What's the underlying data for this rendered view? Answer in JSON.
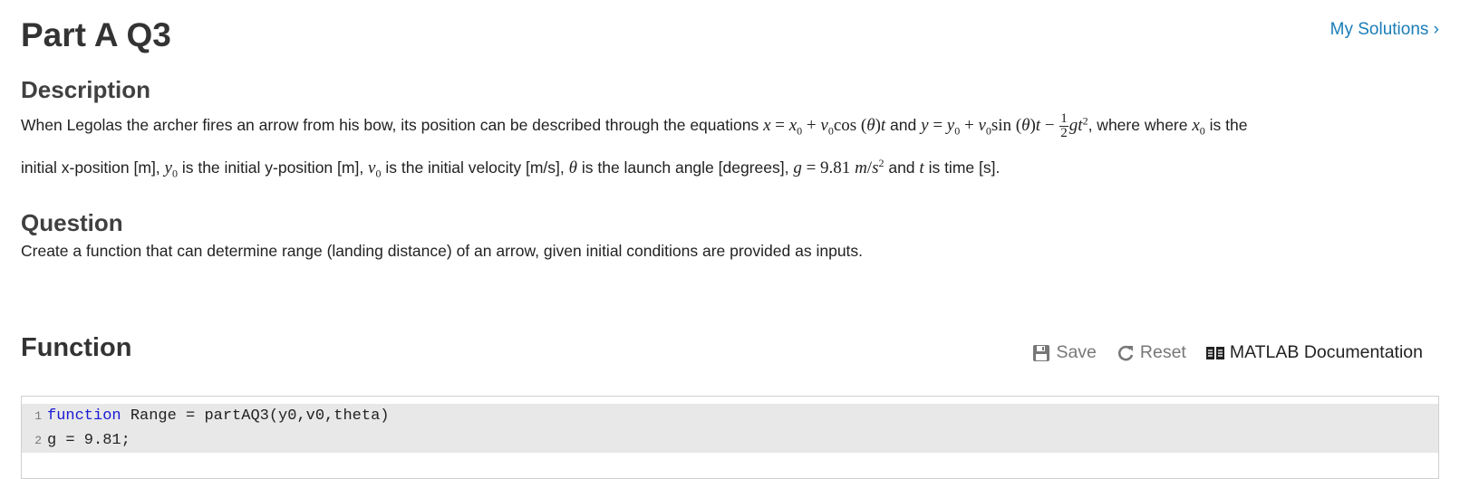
{
  "title": "Part A Q3",
  "my_solutions": "My Solutions ›",
  "description": {
    "heading": "Description",
    "line1_a": "When Legolas the archer fires an arrow from his bow,  its position can be described through the equations ",
    "line1_and": " and ",
    "line1_b": ", where where ",
    "line1_c": " is the",
    "line2_a": "initial x-position [m], ",
    "line2_b": " is the initial y-position [m], ",
    "line2_c": " is the initial velocity [m/s], ",
    "line2_d": " is the launch angle [degrees], ",
    "line2_e": " and ",
    "line2_f": " is time [s]."
  },
  "question": {
    "heading": "Question",
    "text": "Create a function that can determine range (landing distance) of an arrow, given initial conditions are provided as inputs."
  },
  "function_section": {
    "heading": "Function",
    "save_label": "Save",
    "reset_label": "Reset",
    "docs_label": "MATLAB Documentation"
  },
  "code": {
    "lines": [
      {
        "number": "1",
        "keyword": "function",
        "text": " Range = partAQ3(y0,v0,theta)"
      },
      {
        "number": "2",
        "keyword": "",
        "text": "g = 9.81;"
      }
    ]
  },
  "colors": {
    "link": "#1a7db8",
    "keyword": "#1a1ad6",
    "editor_bg": "#e8e8e8"
  },
  "icons": [
    "floppy-disk-icon",
    "reset-arrow-icon",
    "book-icon",
    "chevron-right-icon"
  ]
}
